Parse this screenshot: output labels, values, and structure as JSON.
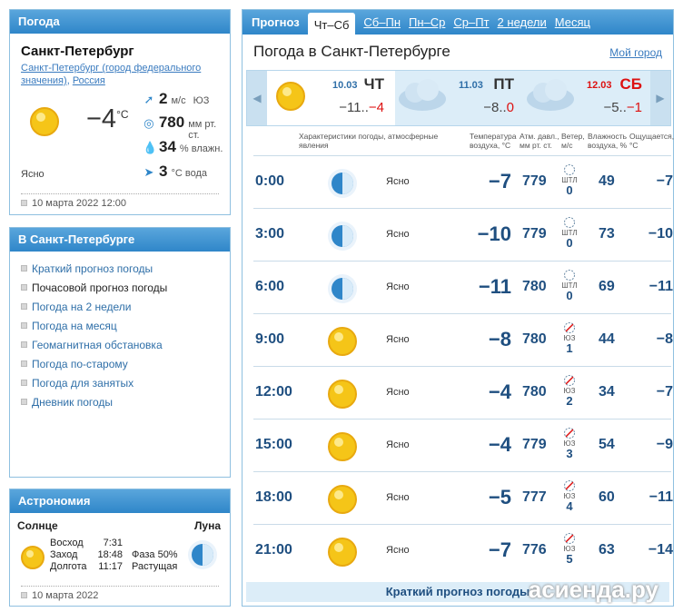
{
  "weather_panel": {
    "title": "Погода",
    "city": "Санкт-Петербург",
    "region_link": "Санкт-Петербург (город федерального значения)",
    "sep": ", ",
    "country_link": "Россия",
    "temp": "−4",
    "temp_unit": "°C",
    "condition": "Ясно",
    "wind_value": "2",
    "wind_unit": "м/с",
    "wind_dir": "ЮЗ",
    "pressure_value": "780",
    "pressure_unit": "мм рт. ст.",
    "humidity_value": "34",
    "humidity_unit": "% влажн.",
    "water_value": "3",
    "water_unit": "°C вода",
    "date": "10 марта 2022 12:00"
  },
  "city_panel": {
    "title": "В Санкт-Петербурге",
    "links": [
      "Краткий прогноз погоды",
      "Почасовой прогноз погоды",
      "Погода на 2 недели",
      "Погода на месяц",
      "Геомагнитная обстановка",
      "Погода по-старому",
      "Погода для занятых",
      "Дневник погоды"
    ]
  },
  "astro_panel": {
    "title": "Астрономия",
    "sun_label": "Солнце",
    "moon_label": "Луна",
    "sunrise_label": "Восход",
    "sunrise": "7:31",
    "sunset_label": "Заход",
    "sunset": "18:48",
    "daylength_label": "Долгота",
    "daylength": "11:17",
    "phase_label": "Фаза 50%",
    "phase_state": "Растущая",
    "date": "10 марта 2022"
  },
  "main": {
    "tabs": [
      "Прогноз",
      "Чт–Сб",
      "Сб–Пн",
      "Пн–Ср",
      "Ср–Пт",
      "2 недели",
      "Месяц"
    ],
    "title": "Погода в Санкт-Петербурге",
    "my_city": "Мой город",
    "days": [
      {
        "date": "10.03",
        "name": "ЧТ",
        "temp_min": "−11..",
        "temp_max": "−4"
      },
      {
        "date": "11.03",
        "name": "ПТ",
        "temp_min": "−8..",
        "temp_max": "0"
      },
      {
        "date": "12.03",
        "name": "СБ",
        "temp_min": "−5..",
        "temp_max": "−1"
      }
    ],
    "headers": {
      "conditions": "Характеристики погоды, атмосферные явления",
      "temp": "Температура воздуха, °С",
      "pressure": "Атм. давл., мм рт. ст.",
      "wind": "Ветер, м/с",
      "humidity": "Влажность воздуха, %",
      "feels": "Ощущается, °С"
    },
    "rows": [
      {
        "time": "0:00",
        "cond": "Ясно",
        "temp": "−7",
        "pres": "779",
        "wdir": "ШТЛ",
        "wspd": "0",
        "hum": "49",
        "feels": "−7"
      },
      {
        "time": "3:00",
        "cond": "Ясно",
        "temp": "−10",
        "pres": "779",
        "wdir": "ШТЛ",
        "wspd": "0",
        "hum": "73",
        "feels": "−10"
      },
      {
        "time": "6:00",
        "cond": "Ясно",
        "temp": "−11",
        "pres": "780",
        "wdir": "ШТЛ",
        "wspd": "0",
        "hum": "69",
        "feels": "−11"
      },
      {
        "time": "9:00",
        "cond": "Ясно",
        "temp": "−8",
        "pres": "780",
        "wdir": "ЮЗ",
        "wspd": "1",
        "hum": "44",
        "feels": "−8"
      },
      {
        "time": "12:00",
        "cond": "Ясно",
        "temp": "−4",
        "pres": "780",
        "wdir": "ЮЗ",
        "wspd": "2",
        "hum": "34",
        "feels": "−7"
      },
      {
        "time": "15:00",
        "cond": "Ясно",
        "temp": "−4",
        "pres": "779",
        "wdir": "ЮЗ",
        "wspd": "3",
        "hum": "54",
        "feels": "−9"
      },
      {
        "time": "18:00",
        "cond": "Ясно",
        "temp": "−5",
        "pres": "777",
        "wdir": "ЮЗ",
        "wspd": "4",
        "hum": "60",
        "feels": "−11"
      },
      {
        "time": "21:00",
        "cond": "Ясно",
        "temp": "−7",
        "pres": "776",
        "wdir": "ЮЗ",
        "wspd": "5",
        "hum": "63",
        "feels": "−14"
      }
    ],
    "footer_link": "Краткий прогноз погоды",
    "watermark": "асиенда.ру"
  }
}
